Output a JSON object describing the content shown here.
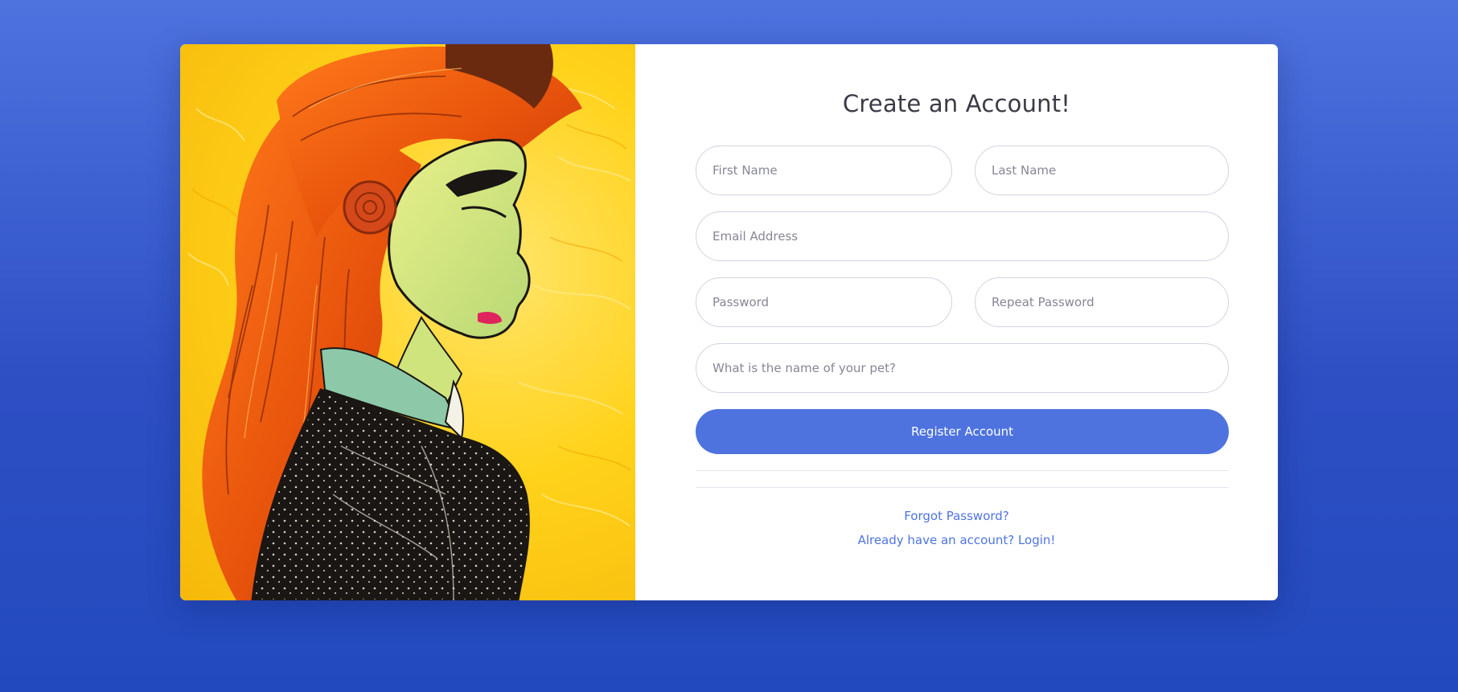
{
  "page": {
    "title": "Create an Account!"
  },
  "form": {
    "first_name": {
      "placeholder": "First Name",
      "value": ""
    },
    "last_name": {
      "placeholder": "Last Name",
      "value": ""
    },
    "email": {
      "placeholder": "Email Address",
      "value": ""
    },
    "password": {
      "placeholder": "Password",
      "value": ""
    },
    "repeat_password": {
      "placeholder": "Repeat Password",
      "value": ""
    },
    "security_question": {
      "placeholder": "What is the name of your pet?",
      "value": ""
    },
    "submit_label": "Register Account"
  },
  "links": {
    "forgot_password": "Forgot Password?",
    "login": "Already have an account? Login!"
  },
  "colors": {
    "primary": "#4e73df",
    "background_top": "#4e73df",
    "background_bottom": "#224abe",
    "title_text": "#3a3b45",
    "placeholder_text": "#858796",
    "field_border": "#d1d3e2"
  },
  "illustration": {
    "description_icon": "portrait-illustration"
  }
}
